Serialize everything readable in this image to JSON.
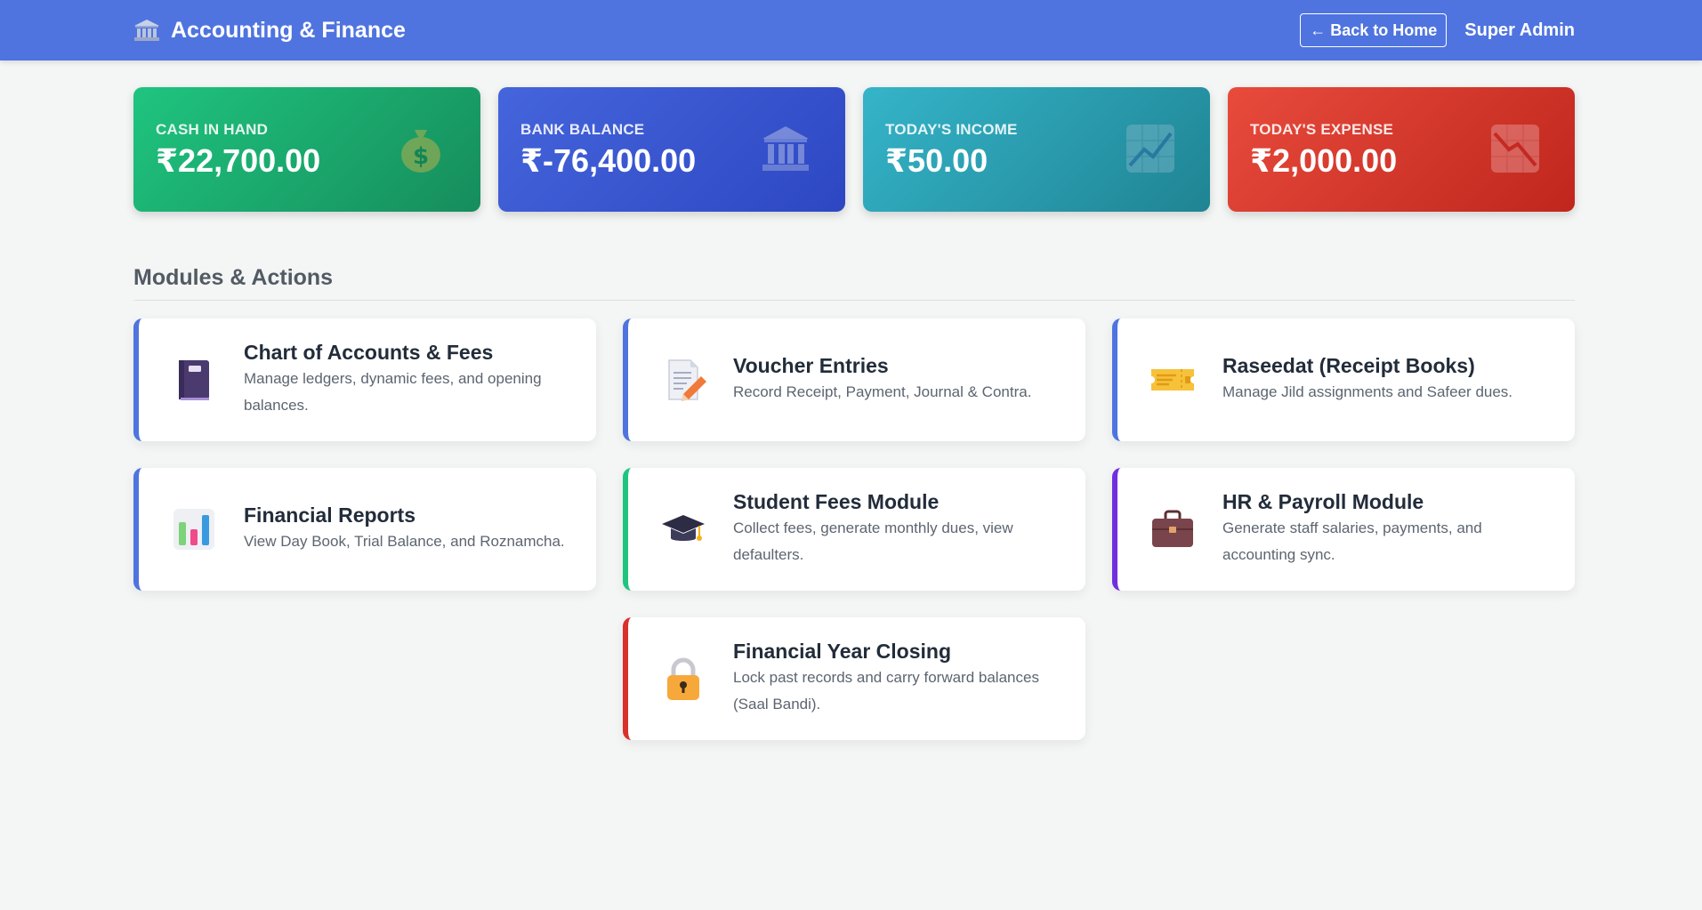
{
  "header": {
    "title": "Accounting & Finance",
    "back_label": "← Back to Home",
    "user": "Super Admin"
  },
  "stats": [
    {
      "label": "Cash in Hand",
      "value": "₹22,700.00",
      "icon": "money-bag-icon"
    },
    {
      "label": "Bank Balance",
      "value": "₹-76,400.00",
      "icon": "bank-icon"
    },
    {
      "label": "Today's Income",
      "value": "₹50.00",
      "icon": "chart-up-icon"
    },
    {
      "label": "Today's Expense",
      "value": "₹2,000.00",
      "icon": "chart-down-icon"
    }
  ],
  "section_title": "Modules & Actions",
  "modules": [
    {
      "title": "Chart of Accounts & Fees",
      "desc": "Manage ledgers, dynamic fees, and opening balances.",
      "icon": "notebook-icon"
    },
    {
      "title": "Voucher Entries",
      "desc": "Record Receipt, Payment, Journal & Contra.",
      "icon": "memo-icon"
    },
    {
      "title": "Raseedat (Receipt Books)",
      "desc": "Manage Jild assignments and Safeer dues.",
      "icon": "ticket-icon"
    },
    {
      "title": "Financial Reports",
      "desc": "View Day Book, Trial Balance, and Roznamcha.",
      "icon": "bar-chart-icon"
    },
    {
      "title": "Student Fees Module",
      "desc": "Collect fees, generate monthly dues, view defaulters.",
      "icon": "graduation-cap-icon"
    },
    {
      "title": "HR & Payroll Module",
      "desc": "Generate staff salaries, payments, and accounting sync.",
      "icon": "briefcase-icon"
    },
    {
      "title": "Financial Year Closing",
      "desc": "Lock past records and carry forward balances (Saal Bandi).",
      "icon": "lock-icon"
    }
  ],
  "colors": {
    "header": "#4f74e0",
    "cash": "#1fc47f",
    "bank": "#3a59d0",
    "income": "#2da0b2",
    "expense": "#d9302a"
  }
}
